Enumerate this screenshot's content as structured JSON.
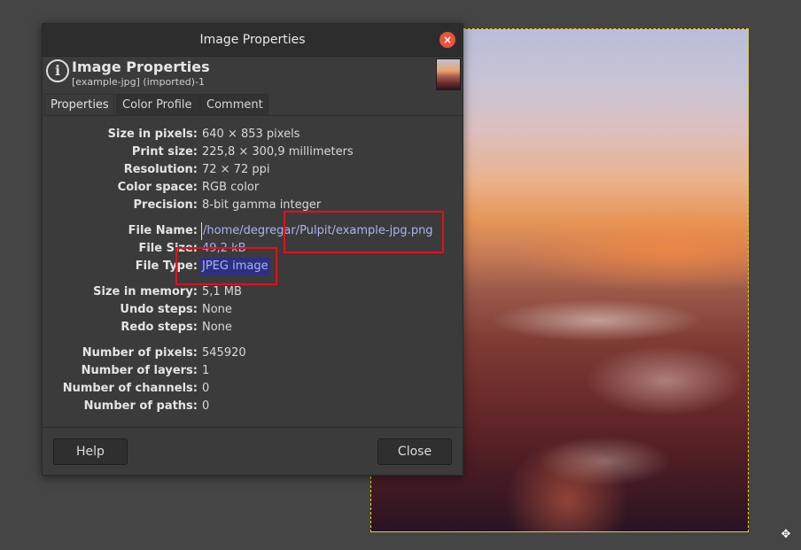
{
  "dialog": {
    "title": "Image Properties",
    "close_icon": "×",
    "header": {
      "title": "Image Properties",
      "subtitle": "[example-jpg] (imported)-1",
      "icon": "i"
    },
    "tabs": [
      {
        "label": "Properties",
        "active": true
      },
      {
        "label": "Color Profile",
        "active": false
      },
      {
        "label": "Comment",
        "active": false
      }
    ],
    "properties": {
      "size_in_pixels": {
        "label": "Size in pixels:",
        "value": "640 × 853 pixels"
      },
      "print_size": {
        "label": "Print size:",
        "value": "225,8 × 300,9 millimeters"
      },
      "resolution": {
        "label": "Resolution:",
        "value": "72 × 72 ppi"
      },
      "color_space": {
        "label": "Color space:",
        "value": "RGB color"
      },
      "precision": {
        "label": "Precision:",
        "value": "8-bit gamma integer"
      },
      "file_name": {
        "label": "File Name:",
        "value": "/home/degregar/Pulpit/example-jpg.png"
      },
      "file_size": {
        "label": "File Size:",
        "value": "49,2 kB"
      },
      "file_type": {
        "label": "File Type:",
        "value": "JPEG image"
      },
      "size_in_memory": {
        "label": "Size in memory:",
        "value": "5,1 MB"
      },
      "undo_steps": {
        "label": "Undo steps:",
        "value": "None"
      },
      "redo_steps": {
        "label": "Redo steps:",
        "value": "None"
      },
      "number_of_pixels": {
        "label": "Number of pixels:",
        "value": "545920"
      },
      "number_of_layers": {
        "label": "Number of layers:",
        "value": "1"
      },
      "number_of_channels": {
        "label": "Number of channels:",
        "value": "0"
      },
      "number_of_paths": {
        "label": "Number of paths:",
        "value": "0"
      }
    },
    "buttons": {
      "help": "Help",
      "close": "Close"
    }
  },
  "colors": {
    "background": "#454545",
    "dialog": "#3b3b3b",
    "titlebar_close": "#e9553c",
    "highlight_box": "#e2101d",
    "selection": "#2d2f83",
    "link_text": "#aab3f0"
  }
}
